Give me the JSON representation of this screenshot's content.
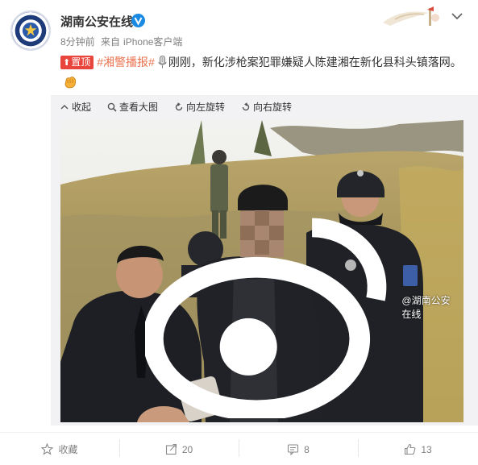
{
  "account": {
    "name": "湖南公安在线",
    "avatar_icon": "police-emblem-avatar",
    "verified_icon": "blue-v-verified-icon",
    "time": "8分钟前",
    "source_prefix": "来自",
    "source": "iPhone客户端"
  },
  "post": {
    "pin_badge": "置顶",
    "topic": "#湘警播报#",
    "text": "刚刚，新化涉枪案犯罪嫌疑人陈建湘在新化县科头镇落网。",
    "icons": [
      "mic-icon",
      "fist-emoji-icon"
    ]
  },
  "viewer": {
    "toolbar": {
      "collapse": "收起",
      "view_large": "查看大图",
      "rotate_left": "向左旋转",
      "rotate_right": "向右旋转"
    },
    "watermark": "@湖南公安在线"
  },
  "actions": {
    "favorite": {
      "label": "收藏",
      "icon": "star-icon"
    },
    "repost": {
      "count": "20",
      "icon": "repost-icon"
    },
    "comment": {
      "count": "8",
      "icon": "comment-icon"
    },
    "like": {
      "count": "13",
      "icon": "thumbs-up-icon"
    }
  },
  "colors": {
    "topic": "#eb7350",
    "pin": "#e8453c",
    "meta": "#808080",
    "viewer_bg": "#f2f2f5"
  }
}
